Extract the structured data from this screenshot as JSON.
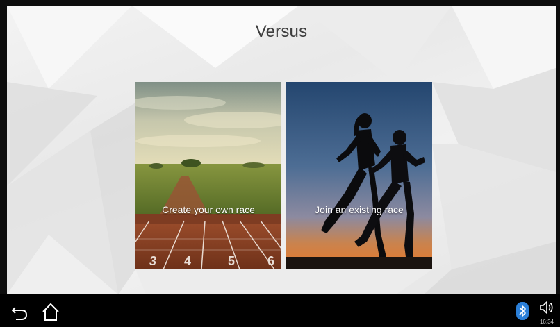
{
  "app": {
    "title": "Versus"
  },
  "cards": [
    {
      "label": "Create your own race",
      "track_numbers": [
        "3",
        "4",
        "5",
        "6"
      ]
    },
    {
      "label": "Join an existing race"
    }
  ],
  "navbar": {
    "back_icon": "back-arrow-icon",
    "home_icon": "home-icon"
  },
  "status": {
    "bluetooth_icon": "bluetooth-icon",
    "volume_icon": "volume-icon",
    "time": "16:34"
  },
  "colors": {
    "accent_bluetooth": "#2b7fd8",
    "title_text": "#3d3d3d",
    "navbar_bg": "#000000"
  }
}
